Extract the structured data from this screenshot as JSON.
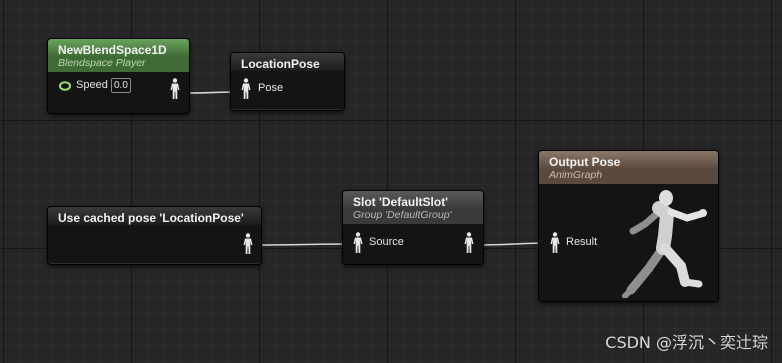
{
  "nodes": {
    "blendspace": {
      "title": "NewBlendSpace1D",
      "subtitle": "Blendspace Player",
      "speed_label": "Speed",
      "speed_value": "0.0"
    },
    "location_pose": {
      "title": "LocationPose",
      "pin_label": "Pose"
    },
    "cached_pose": {
      "title": "Use cached pose 'LocationPose'"
    },
    "slot": {
      "title": "Slot 'DefaultSlot'",
      "subtitle": "Group 'DefaultGroup'",
      "pin_label": "Source"
    },
    "output": {
      "title": "Output Pose",
      "subtitle": "AnimGraph",
      "pin_label": "Result"
    }
  },
  "colors": {
    "blendspace_header": "#69a35c",
    "slot_header": "#5a5a5a",
    "output_header": "#8a7868",
    "speed_pin": "#9be07a",
    "wire": "#d8d8d8"
  },
  "icons": [
    "pose-pin-icon",
    "float-pin-icon",
    "running-mannequin-icon"
  ],
  "watermark": "CSDN @浮沉丶奕辻琮"
}
